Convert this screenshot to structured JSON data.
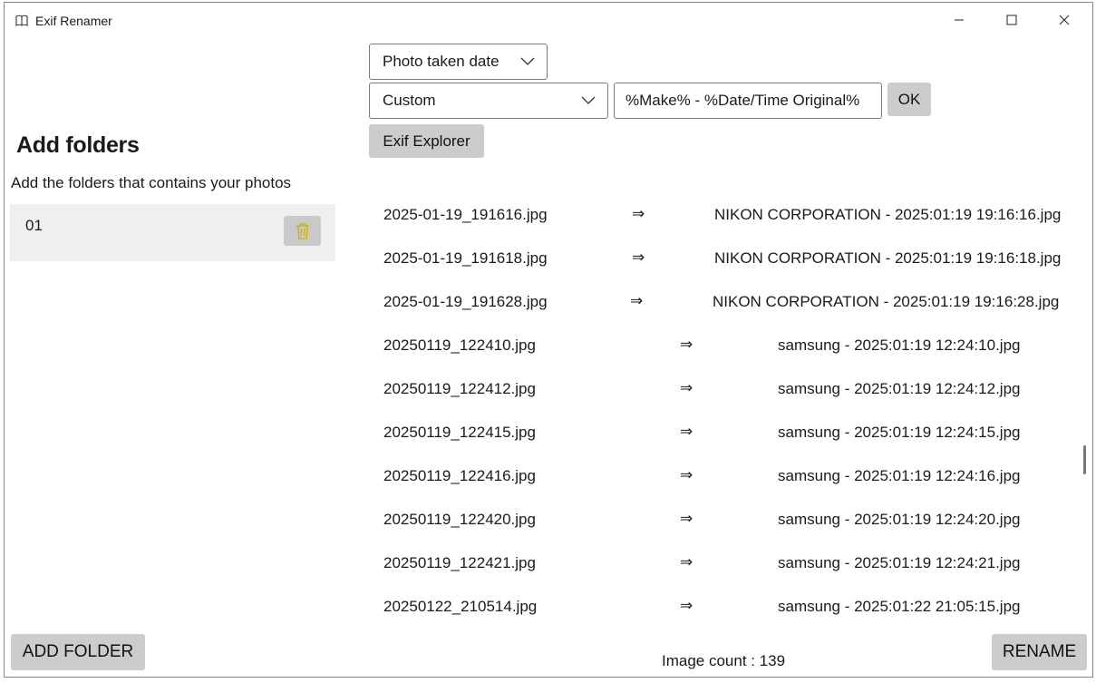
{
  "window": {
    "title": "Exif Renamer",
    "app_icon": "book-icon"
  },
  "left": {
    "heading": "Add folders",
    "subtitle": "Add the folders that contains your photos",
    "folders": [
      {
        "name": "01",
        "delete_icon": "trash-icon"
      }
    ],
    "add_folder_label": "ADD FOLDER"
  },
  "controls": {
    "mode_selected": "Photo taken date",
    "format_selected": "Custom",
    "pattern_value": "%Make% - %Date/Time Original%",
    "ok_label": "OK",
    "exif_explorer_label": "Exif Explorer"
  },
  "files": [
    {
      "source": "2025-01-19_191616.jpg",
      "arrow": "⇒",
      "target": "NIKON CORPORATION - 2025:01:19 19:16:16.jpg"
    },
    {
      "source": "2025-01-19_191618.jpg",
      "arrow": "⇒",
      "target": "NIKON CORPORATION - 2025:01:19 19:16:18.jpg"
    },
    {
      "source": "2025-01-19_191628.jpg",
      "arrow": "⇒",
      "target": "NIKON CORPORATION - 2025:01:19 19:16:28.jpg"
    },
    {
      "source": "20250119_122410.jpg",
      "arrow": "⇒",
      "target": "samsung - 2025:01:19 12:24:10.jpg"
    },
    {
      "source": "20250119_122412.jpg",
      "arrow": "⇒",
      "target": "samsung - 2025:01:19 12:24:12.jpg"
    },
    {
      "source": "20250119_122415.jpg",
      "arrow": "⇒",
      "target": "samsung - 2025:01:19 12:24:15.jpg"
    },
    {
      "source": "20250119_122416.jpg",
      "arrow": "⇒",
      "target": "samsung - 2025:01:19 12:24:16.jpg"
    },
    {
      "source": "20250119_122420.jpg",
      "arrow": "⇒",
      "target": "samsung - 2025:01:19 12:24:20.jpg"
    },
    {
      "source": "20250119_122421.jpg",
      "arrow": "⇒",
      "target": "samsung - 2025:01:19 12:24:21.jpg"
    },
    {
      "source": "20250122_210514.jpg",
      "arrow": "⇒",
      "target": "samsung - 2025:01:22 21:05:15.jpg"
    }
  ],
  "footer": {
    "image_count": "Image count : 139",
    "rename_label": "RENAME"
  },
  "colors": {
    "button_bg": "#cccccc",
    "delete_icon": "#c8b400",
    "panel_bg": "#efefef"
  }
}
